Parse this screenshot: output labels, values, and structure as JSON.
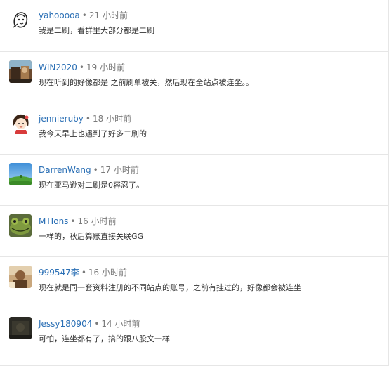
{
  "separator": "•",
  "comments": [
    {
      "author": "yahooooa",
      "time": "21 小时前",
      "text": "我是二刷，看群里大部分都是二刷",
      "avatar_icon": "portrait-sketch-icon"
    },
    {
      "author": "WIN2020",
      "time": "19 小时前",
      "text": "现在听到的好像都是 之前刷单被关，然后现在全站点被连坐。。",
      "avatar_icon": "photo-avatar-icon"
    },
    {
      "author": "jennieruby",
      "time": "18 小时前",
      "text": "我今天早上也遇到了好多二刷的",
      "avatar_icon": "cartoon-girl-icon"
    },
    {
      "author": "DarrenWang",
      "time": "17 小时前",
      "text": "现在亚马逊对二刷是0容忍了。",
      "avatar_icon": "landscape-icon"
    },
    {
      "author": "MTIons",
      "time": "16 小时前",
      "text": "一样的，秋后算账直接关联GG",
      "avatar_icon": "frog-icon"
    },
    {
      "author": "999547李",
      "time": "16 小时前",
      "text": "现在就是同一套资料注册的不同站点的账号，之前有挂过的，好像都会被连坐",
      "avatar_icon": "photo-avatar-icon"
    },
    {
      "author": "Jessy180904",
      "time": "14 小时前",
      "text": "可怕，连坐都有了，搞的跟八股文一样",
      "avatar_icon": "dark-photo-icon"
    }
  ]
}
